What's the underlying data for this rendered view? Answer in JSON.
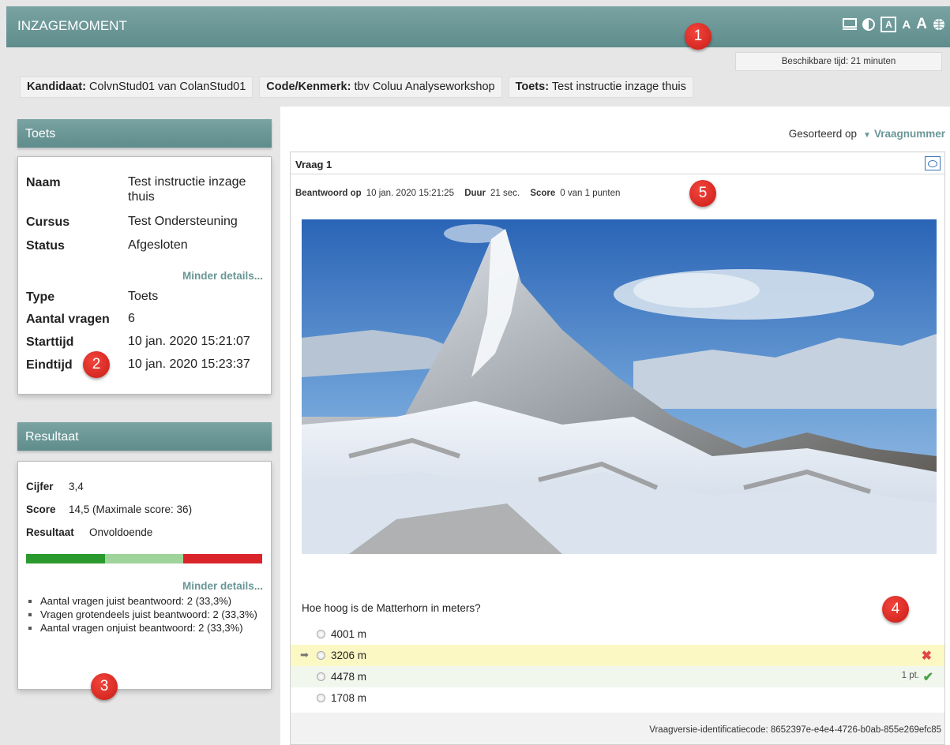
{
  "app": {
    "title": "INZAGEMOMENT"
  },
  "toolbar": {
    "icons": [
      "monitor-icon",
      "contrast-icon",
      "font-small-icon",
      "font-medium-icon",
      "font-large-icon",
      "globe-icon"
    ],
    "a_small": "A",
    "a_medium": "A",
    "a_large": "A"
  },
  "timer": "Beschikbare tijd: 21 minuten",
  "info": {
    "candidate_label": "Kandidaat:",
    "candidate_value": "ColvnStud01 van ColanStud01",
    "code_label": "Code/Kenmerk:",
    "code_value": "tbv Coluu Analyseworkshop",
    "test_label": "Toets:",
    "test_value": "Test instructie inzage thuis"
  },
  "test_panel": {
    "title": "Toets",
    "rows": [
      {
        "key": "Naam",
        "value": "Test instructie inzage thuis"
      },
      {
        "key": "Cursus",
        "value": "Test Ondersteuning"
      },
      {
        "key": "Status",
        "value": "Afgesloten"
      },
      {
        "key": "Type",
        "value": "Toets"
      },
      {
        "key": "Aantal vragen",
        "value": "6"
      },
      {
        "key": "Starttijd",
        "value": "10 jan. 2020 15:21:07"
      },
      {
        "key": "Eindtijd",
        "value": "10 jan. 2020 15:23:37"
      }
    ],
    "less_details": "Minder details..."
  },
  "result_panel": {
    "title": "Resultaat",
    "grade_label": "Cijfer",
    "grade_value": "3,4",
    "score_label": "Score",
    "score_value": "14,5 (Maximale score: 36)",
    "result_label": "Resultaat",
    "result_value": "Onvoldoende",
    "bar": [
      {
        "fraction": 0.333,
        "color": "#2a9a2e"
      },
      {
        "fraction": 0.333,
        "color": "#9ed39a"
      },
      {
        "fraction": 0.334,
        "color": "#d9242a"
      }
    ],
    "less_details": "Minder details...",
    "bullets": [
      "Aantal vragen juist beantwoord: 2 (33,3%)",
      "Vragen grotendeels juist beantwoord: 2 (33,3%)",
      "Aantal vragen onjuist beantwoord: 2 (33,3%)"
    ]
  },
  "sort": {
    "label": "Gesorteerd op",
    "value": "Vraagnummer"
  },
  "question": {
    "title": "Vraag 1",
    "answered_label": "Beantwoord op",
    "answered_value": "10 jan. 2020 15:21:25",
    "duration_label": "Duur",
    "duration_value": "21 sec.",
    "score_label": "Score",
    "score_value": "0 van 1 punten",
    "text": "Hoe hoog is de Matterhorn in meters?",
    "options": [
      "4001 m",
      "3206 m",
      "4478 m",
      "1708 m"
    ],
    "selected_option": "3206 m",
    "correct_option": "4478 m",
    "correct_points": "1 pt.",
    "version_code": "Vraagversie-identificatiecode: 8652397e-e4e4-4726-b0ab-855e269efc85"
  },
  "callouts": [
    "1",
    "2",
    "3",
    "4",
    "5"
  ]
}
